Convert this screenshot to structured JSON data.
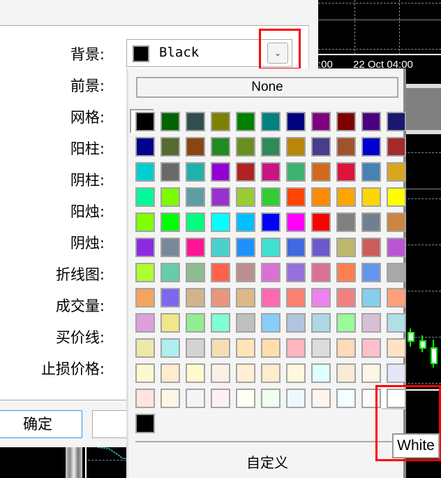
{
  "chart": {
    "time_label": "22 Oct 04:00",
    "time_label_left": ":00"
  },
  "dialog": {
    "labels": [
      "背景:",
      "前景:",
      "网格:",
      "阳柱:",
      "阴柱:",
      "阳烛:",
      "阴烛:",
      "折线图:",
      "成交量:",
      "买价线:",
      "止损价格:"
    ],
    "background_combo": {
      "value": "Black",
      "swatch_color": "#000000"
    },
    "ok_label": "确定",
    "cancel_label": ""
  },
  "color_popup": {
    "none_label": "None",
    "custom_label": "自定义",
    "tooltip": "White",
    "selected": "Black",
    "hovered": "White",
    "colors": [
      [
        "#000000",
        "#006400",
        "#2F4F4F",
        "#808000",
        "#008000",
        "#008080",
        "#000080",
        "#800080",
        "#800000",
        "#4B0082",
        "#191970"
      ],
      [
        "#00008B",
        "#556B2F",
        "#8B4513",
        "#228B22",
        "#6B8E23",
        "#2E8B57",
        "#B8860B",
        "#483D8B",
        "#A0522D",
        "#0000CD",
        "#A52A2A"
      ],
      [
        "#00CED1",
        "#696969",
        "#20B2AA",
        "#9400D3",
        "#B22222",
        "#C71585",
        "#3CB371",
        "#D2691E",
        "#DC143C",
        "#4682B4",
        "#DAA520"
      ],
      [
        "#00FA9A",
        "#7CFC00",
        "#5F9EA0",
        "#9932CC",
        "#9ACD32",
        "#32CD32",
        "#FF4500",
        "#FF8C00",
        "#FFA500",
        "#FFD700",
        "#FFFF00"
      ],
      [
        "#7FFF00",
        "#00FF00",
        "#00FF7F",
        "#00FFFF",
        "#00BFFF",
        "#0000FF",
        "#FF00FF",
        "#FF0000",
        "#808080",
        "#708090",
        "#CD853F"
      ],
      [
        "#8A2BE2",
        "#778899",
        "#FF1493",
        "#48D1CC",
        "#1E90FF",
        "#40E0D0",
        "#4169E1",
        "#6A5ACD",
        "#BDB76B",
        "#CD5C5C",
        "#BA55D3"
      ],
      [
        "#ADFF2F",
        "#66CDAA",
        "#8FBC8F",
        "#FF6347",
        "#BC8F8F",
        "#DA70D6",
        "#9370DB",
        "#DB7093",
        "#FF7F50",
        "#6495ED",
        "#A9A9A9"
      ],
      [
        "#F4A460",
        "#7B68EE",
        "#D2B48C",
        "#E9967A",
        "#DEB887",
        "#FF69B4",
        "#FA8072",
        "#EE82EE",
        "#F08080",
        "#87CEEB",
        "#FFA07A"
      ],
      [
        "#DDA0DD",
        "#F0E68C",
        "#90EE90",
        "#7FFFD4",
        "#C0C0C0",
        "#87CEFA",
        "#B0C4DE",
        "#ADD8E6",
        "#98FB98",
        "#D8BFD8",
        "#B0E0E6"
      ],
      [
        "#EEE8AA",
        "#AFEEEE",
        "#D3D3D3",
        "#F5DEB3",
        "#FFE4B5",
        "#FFDEAD",
        "#FFB6C1",
        "#DCDCDC",
        "#FFDAB9",
        "#FFC0CB",
        "#FFE4C4"
      ],
      [
        "#FAFAD2",
        "#FFEBCD",
        "#FFFACD",
        "#FAF0E6",
        "#FFEFD5",
        "#FFEBCD",
        "#FFF8DC",
        "#E0FFFF",
        "#FAEBD7",
        "#FDF5E6",
        "#E6E6FA"
      ],
      [
        "#FFE4E1",
        "#FDF5E6",
        "#F5F5F5",
        "#FFF0F5",
        "#FFFFF0",
        "#F0FFF0",
        "#F0F8FF",
        "#FFF5EE",
        "#F0FFFF",
        "#FFFAFA",
        "#FFFFFF"
      ],
      [
        "#000000"
      ]
    ]
  }
}
